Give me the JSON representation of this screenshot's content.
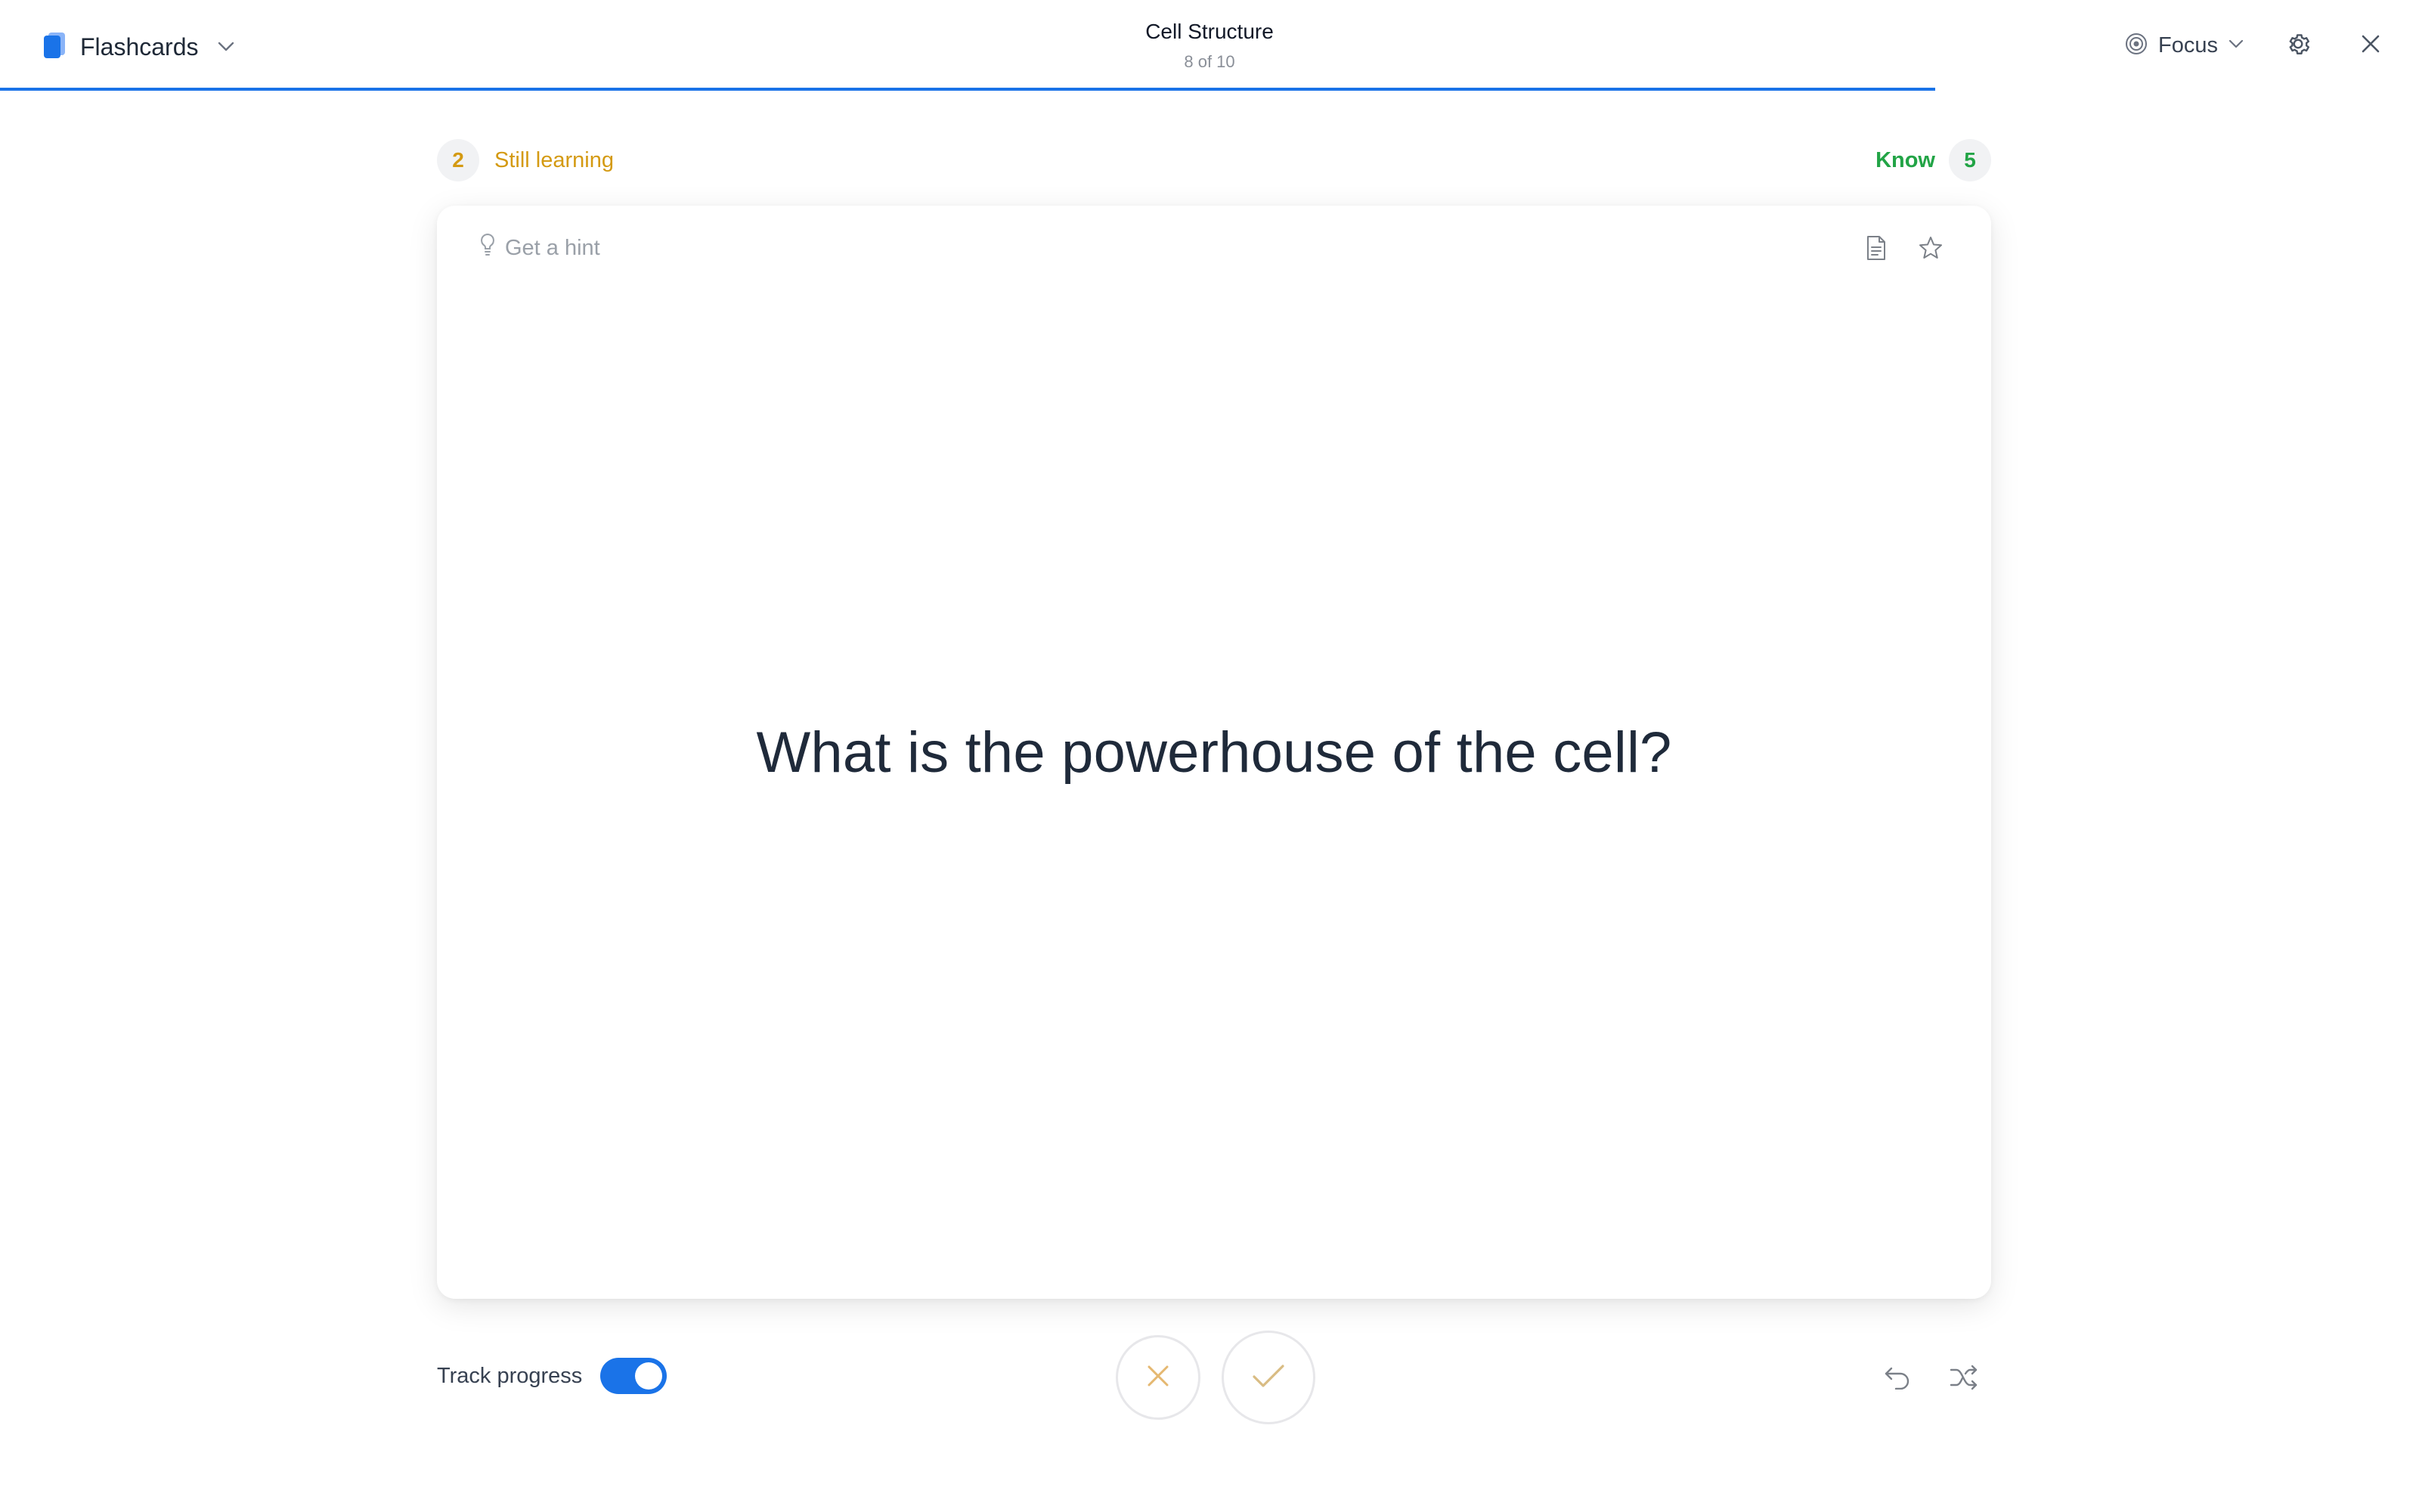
{
  "app": {
    "name": "Flashcards",
    "accent_color": "#1a73e8",
    "icon": "flashcards-icon"
  },
  "header": {
    "deck_title": "Cell Structure",
    "position_text": "8 of 10",
    "progress_fraction": 0.8,
    "focus_label": "Focus",
    "focus_icon": "target-icon",
    "settings_icon": "gear-icon",
    "close_icon": "close-icon"
  },
  "counts": {
    "learning_count": "2",
    "learning_label": "Still learning",
    "learning_color": "#d49a12",
    "know_label": "Know",
    "know_count": "5",
    "know_color": "#22a446"
  },
  "card": {
    "hint_label": "Get a hint",
    "hint_icon": "lightbulb-icon",
    "question": "What is the powerhouse of the cell?",
    "tools": [
      "document-icon",
      "star-icon"
    ]
  },
  "footer": {
    "track_label": "Track progress",
    "track_enabled": true,
    "wrong_icon": "x-icon",
    "correct_icon": "check-icon",
    "undo_icon": "undo-icon",
    "shuffle_icon": "shuffle-icon"
  }
}
